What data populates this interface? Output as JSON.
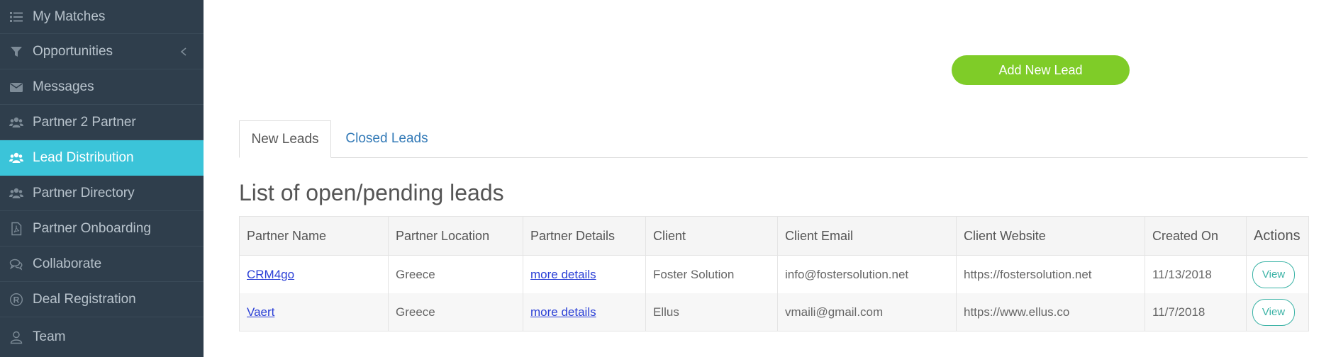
{
  "sidebar": {
    "items": [
      {
        "label": "My Matches",
        "icon": "list-icon"
      },
      {
        "label": "Opportunities",
        "icon": "filter-icon"
      },
      {
        "label": "Messages",
        "icon": "envelope-icon"
      },
      {
        "label": "Partner 2 Partner",
        "icon": "users-icon"
      },
      {
        "label": "Lead Distribution",
        "icon": "users-icon",
        "active": true
      },
      {
        "label": "Partner Directory",
        "icon": "users-icon"
      },
      {
        "label": "Partner Onboarding",
        "icon": "file-pdf-icon"
      },
      {
        "label": "Collaborate",
        "icon": "comments-icon"
      },
      {
        "label": "Deal Registration",
        "icon": "registered-icon"
      },
      {
        "label": "Team",
        "icon": "user-icon"
      }
    ]
  },
  "actions": {
    "add_lead": "Add New Lead"
  },
  "tabs": [
    {
      "label": "New Leads",
      "active": true
    },
    {
      "label": "Closed Leads",
      "active": false
    }
  ],
  "heading": "List of open/pending leads",
  "table": {
    "headers": [
      "Partner Name",
      "Partner Location",
      "Partner Details",
      "Client",
      "Client Email",
      "Client Website",
      "Created On",
      "Actions"
    ],
    "rows": [
      {
        "partner_name": "CRM4go",
        "partner_location": "Greece",
        "partner_details": "more details",
        "client": "Foster Solution",
        "client_email": "info@fostersolution.net",
        "client_website": "https://fostersolution.net",
        "created_on": "11/13/2018",
        "action": "View"
      },
      {
        "partner_name": "Vaert",
        "partner_location": "Greece",
        "partner_details": "more details",
        "client": "Ellus",
        "client_email": "vmaili@gmail.com",
        "client_website": "https://www.ellus.co",
        "created_on": "11/7/2018",
        "action": "View"
      }
    ]
  },
  "colors": {
    "sidebar_bg": "#2f3e4c",
    "active_item": "#3bc4d9",
    "add_button": "#7fcc28",
    "view_button": "#3bb3a6",
    "link": "#2a3fd6"
  }
}
